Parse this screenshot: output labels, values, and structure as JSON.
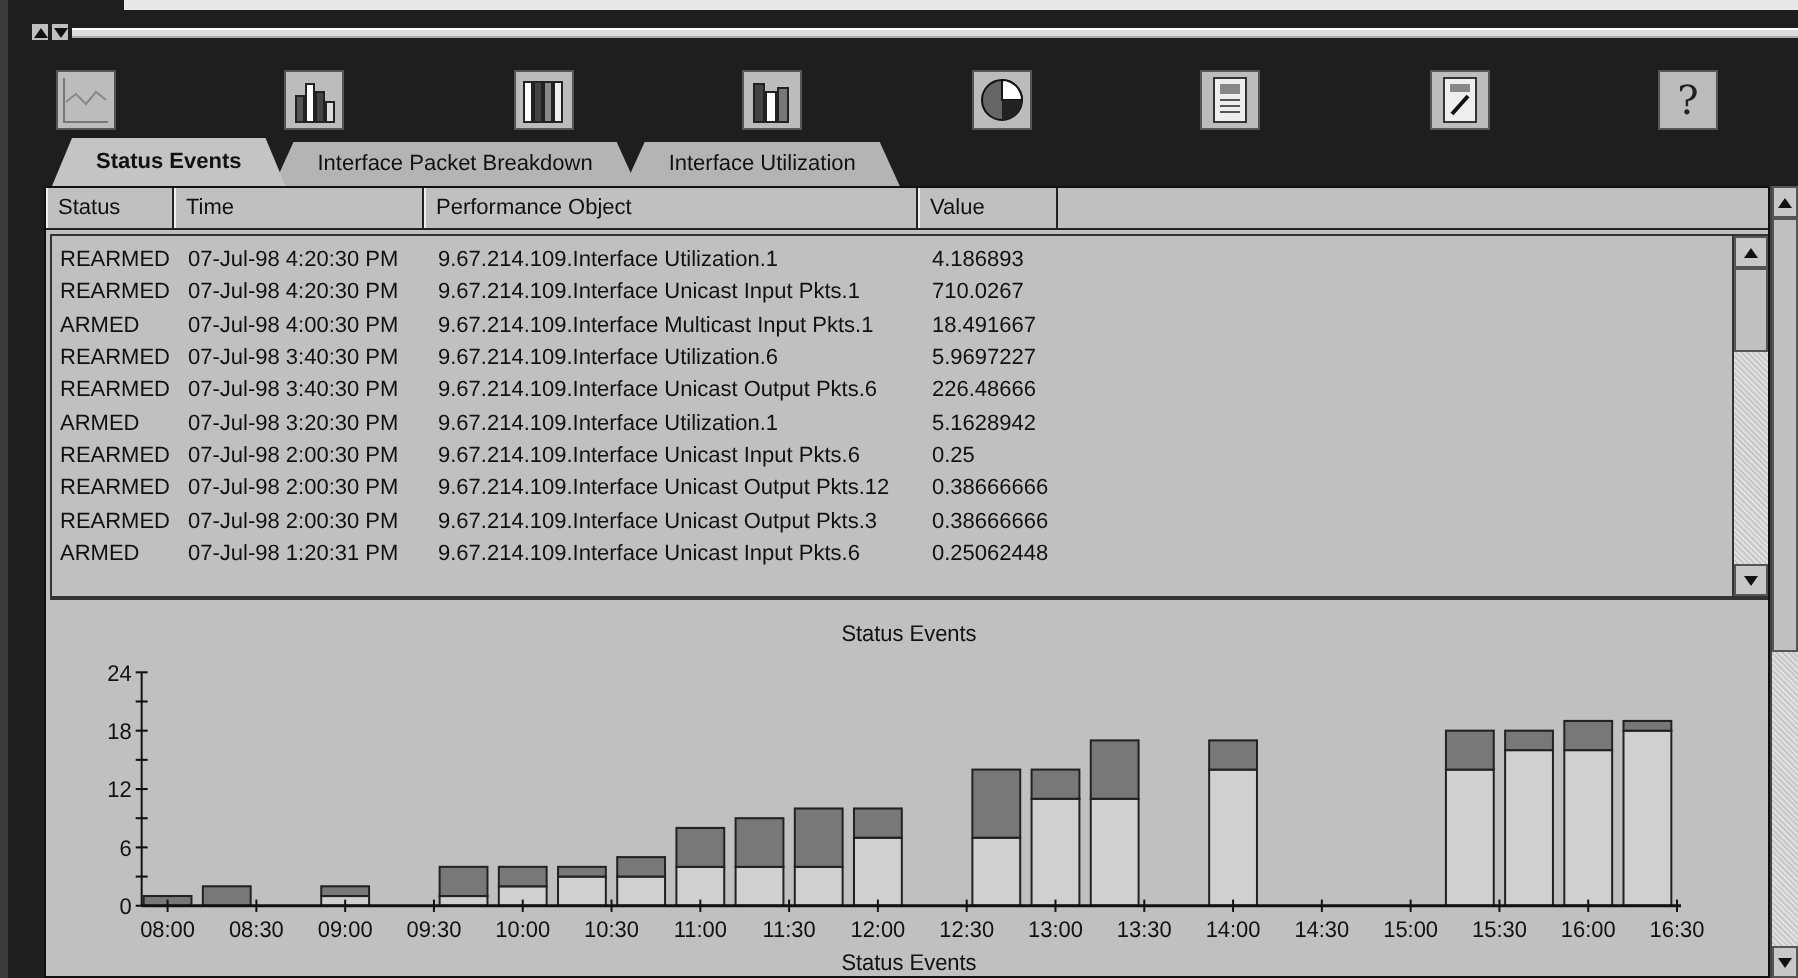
{
  "toolbar": {
    "buttons": [
      {
        "kind": "line"
      },
      {
        "kind": "stacked"
      },
      {
        "kind": "stacked2"
      },
      {
        "kind": "bars"
      },
      {
        "kind": "pie"
      },
      {
        "kind": "report"
      },
      {
        "kind": "edit"
      },
      {
        "kind": "help",
        "label": "?"
      }
    ]
  },
  "tabs": [
    {
      "label": "Status Events",
      "selected": true
    },
    {
      "label": "Interface Packet Breakdown",
      "selected": false
    },
    {
      "label": "Interface Utilization",
      "selected": false
    }
  ],
  "table": {
    "columns": [
      "Status",
      "Time",
      "Performance Object",
      "Value"
    ],
    "rows": [
      [
        "REARMED",
        "07-Jul-98 4:20:30 PM",
        "9.67.214.109.Interface Utilization.1",
        "4.186893"
      ],
      [
        "REARMED",
        "07-Jul-98 4:20:30 PM",
        "9.67.214.109.Interface Unicast Input Pkts.1",
        "710.0267"
      ],
      [
        "ARMED",
        "07-Jul-98 4:00:30 PM",
        "9.67.214.109.Interface Multicast Input Pkts.1",
        "18.491667"
      ],
      [
        "REARMED",
        "07-Jul-98 3:40:30 PM",
        "9.67.214.109.Interface Utilization.6",
        "5.9697227"
      ],
      [
        "REARMED",
        "07-Jul-98 3:40:30 PM",
        "9.67.214.109.Interface Unicast Output Pkts.6",
        "226.48666"
      ],
      [
        "ARMED",
        "07-Jul-98 3:20:30 PM",
        "9.67.214.109.Interface Utilization.1",
        "5.1628942"
      ],
      [
        "REARMED",
        "07-Jul-98 2:00:30 PM",
        "9.67.214.109.Interface Unicast Input Pkts.6",
        "0.25"
      ],
      [
        "REARMED",
        "07-Jul-98 2:00:30 PM",
        "9.67.214.109.Interface Unicast Output Pkts.12",
        "0.38666666"
      ],
      [
        "REARMED",
        "07-Jul-98 2:00:30 PM",
        "9.67.214.109.Interface Unicast Output Pkts.3",
        "0.38666666"
      ],
      [
        "ARMED",
        "07-Jul-98 1:20:31 PM",
        "9.67.214.109.Interface Unicast Input Pkts.6",
        "0.25062448"
      ]
    ]
  },
  "chart_data": {
    "type": "bar",
    "stacked": true,
    "title": "Status Events",
    "xlabel": "Status Events",
    "categories": [
      "08:00",
      null,
      null,
      "08:30",
      null,
      null,
      "09:00",
      null,
      null,
      "09:30",
      null,
      null,
      "10:00",
      null,
      null,
      "10:30",
      null,
      null,
      "11:00",
      null,
      null,
      "11:30",
      null,
      null,
      "12:00",
      null,
      null,
      "12:30",
      null,
      null,
      "13:00",
      null,
      null,
      "13:30",
      null,
      null,
      "14:00",
      null,
      null,
      "14:30",
      null,
      null,
      "15:00",
      null,
      null,
      "15:30",
      null,
      null,
      "16:00",
      null,
      null,
      "16:30"
    ],
    "series": [
      {
        "color": "#d0d0d0",
        "values": [
          0,
          null,
          0,
          null,
          null,
          null,
          1,
          null,
          null,
          null,
          1,
          null,
          2,
          null,
          3,
          null,
          3,
          null,
          4,
          null,
          4,
          null,
          4,
          null,
          7,
          null,
          null,
          null,
          7,
          null,
          11,
          null,
          11,
          null,
          null,
          null,
          14,
          null,
          null,
          null,
          null,
          null,
          null,
          null,
          14,
          null,
          16,
          null,
          16,
          null,
          18,
          null
        ]
      },
      {
        "color": "#787878",
        "values": [
          1,
          null,
          2,
          null,
          null,
          null,
          1,
          null,
          null,
          null,
          3,
          null,
          2,
          null,
          1,
          null,
          2,
          null,
          4,
          null,
          5,
          null,
          6,
          null,
          3,
          null,
          null,
          null,
          7,
          null,
          3,
          null,
          6,
          null,
          null,
          null,
          3,
          null,
          null,
          null,
          null,
          null,
          null,
          null,
          4,
          null,
          2,
          null,
          3,
          null,
          1,
          null
        ]
      }
    ],
    "ylim": [
      0,
      24
    ],
    "yticks": [
      0,
      6,
      12,
      18,
      24
    ]
  }
}
